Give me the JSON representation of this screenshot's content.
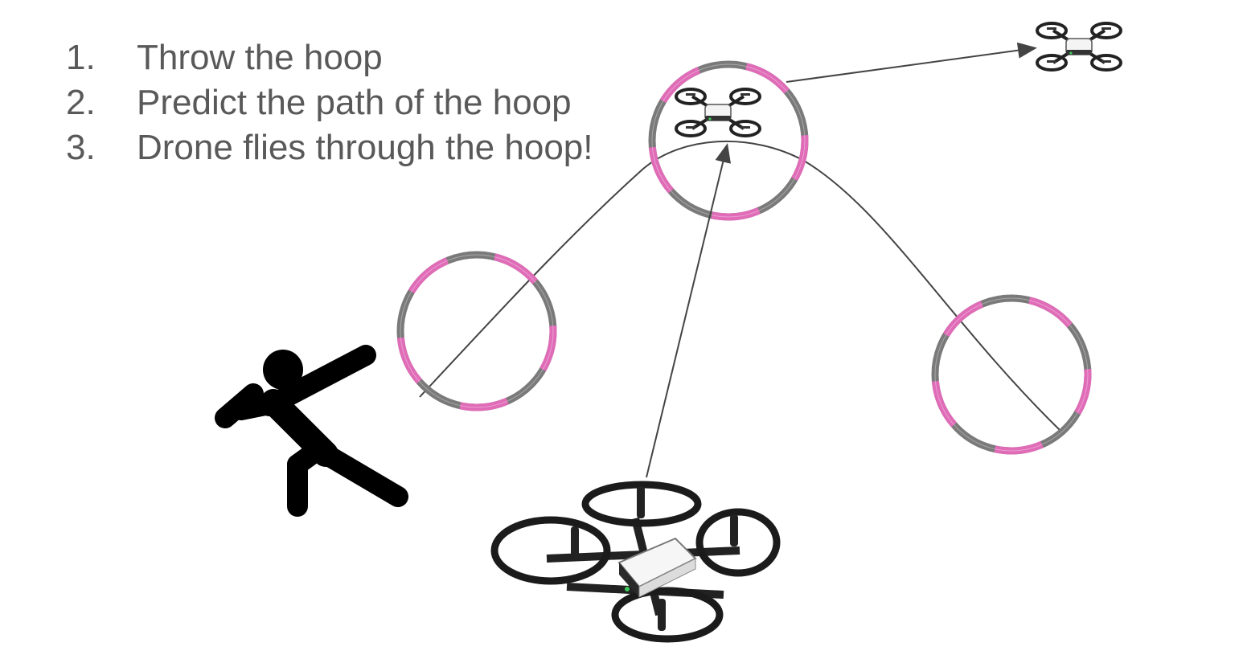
{
  "steps": [
    {
      "number": "1.",
      "text": "Throw the hoop"
    },
    {
      "number": "2.",
      "text": "Predict the path of the hoop"
    },
    {
      "number": "3.",
      "text": "Drone flies through the hoop!"
    }
  ],
  "colors": {
    "text": "#595959",
    "hoop_pink": "#e06cb8",
    "hoop_gray": "#7a7a7a",
    "path_line": "#444444",
    "figure": "#000000"
  },
  "icons": [
    "thrower-figure-icon",
    "hoop-icon",
    "drone-icon",
    "arrow-icon"
  ]
}
